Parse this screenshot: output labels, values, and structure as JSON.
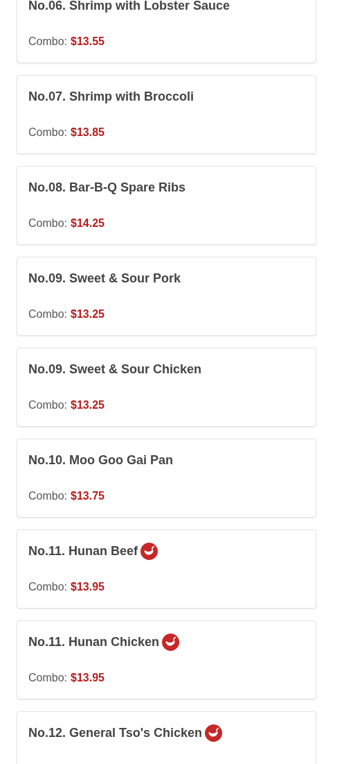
{
  "menu_items": [
    {
      "title": "No.06. Shrimp with Lobster Sauce",
      "spicy": false,
      "combo_label": "Combo:",
      "price": "$13.55"
    },
    {
      "title": "No.07. Shrimp with Broccoli",
      "spicy": false,
      "combo_label": "Combo:",
      "price": "$13.85"
    },
    {
      "title": "No.08. Bar-B-Q Spare Ribs",
      "spicy": false,
      "combo_label": "Combo:",
      "price": "$14.25"
    },
    {
      "title": "No.09. Sweet & Sour Pork",
      "spicy": false,
      "combo_label": "Combo:",
      "price": "$13.25"
    },
    {
      "title": "No.09. Sweet & Sour Chicken",
      "spicy": false,
      "combo_label": "Combo:",
      "price": "$13.25"
    },
    {
      "title": "No.10. Moo Goo Gai Pan",
      "spicy": false,
      "combo_label": "Combo:",
      "price": "$13.75"
    },
    {
      "title": "No.11. Hunan Beef",
      "spicy": true,
      "combo_label": "Combo:",
      "price": "$13.95"
    },
    {
      "title": "No.11. Hunan Chicken",
      "spicy": true,
      "combo_label": "Combo:",
      "price": "$13.95"
    },
    {
      "title": "No.12. General Tso's Chicken",
      "spicy": true
    }
  ]
}
